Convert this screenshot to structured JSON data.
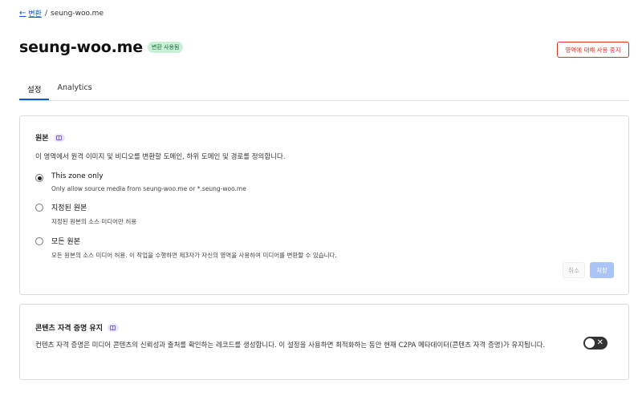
{
  "breadcrumb": {
    "back_arrow": "←",
    "back_label": "변환",
    "separator": "/",
    "current": "seung-woo.me"
  },
  "header": {
    "title": "seung-woo.me",
    "badge": "변환 사용됨",
    "disable_button": "영역에 대해 사용 중지"
  },
  "tabs": [
    {
      "label": "설정",
      "active": true
    },
    {
      "label": "Analytics",
      "active": false
    }
  ],
  "origins_card": {
    "title": "원본",
    "title_icon": "doc-icon",
    "description": "이 영역에서 원격 이미지 및 비디오를 변환할 도메인, 하위 도메인 및 경로를 정의합니다.",
    "options": [
      {
        "label": "This zone only",
        "sub": "Only allow source media from seung-woo.me or *.seung-woo.me",
        "checked": true
      },
      {
        "label": "지정된 원본",
        "sub": "지정된 원본의 소스 미디어만 허용",
        "checked": false
      },
      {
        "label": "모든 원본",
        "sub": "모든 원본의 소스 미디어 허용. 이 작업을 수행하면 제3자가 자신의 영역을 사용하여 미디어를 변환할 수 있습니다.",
        "checked": false
      }
    ],
    "cancel_label": "취소",
    "save_label": "저장"
  },
  "credentials_card": {
    "title": "콘텐츠 자격 증명 유지",
    "title_icon": "doc-icon",
    "description": "컨텐츠 자격 증명은 미디어 콘텐츠의 신뢰성과 출처를 확인하는 레코드를 생성합니다. 이 설정을 사용하면 최적화하는 동안 현재 C2PA 메타데이터(콘텐츠 자격 증명)가 유지됩니다.",
    "toggle_on": false,
    "toggle_symbol": "✕"
  },
  "colors": {
    "accent": "#0b57d0",
    "danger": "#d93025",
    "badge_bg": "#c9efd6",
    "save_disabled": "#a9c4f5"
  }
}
